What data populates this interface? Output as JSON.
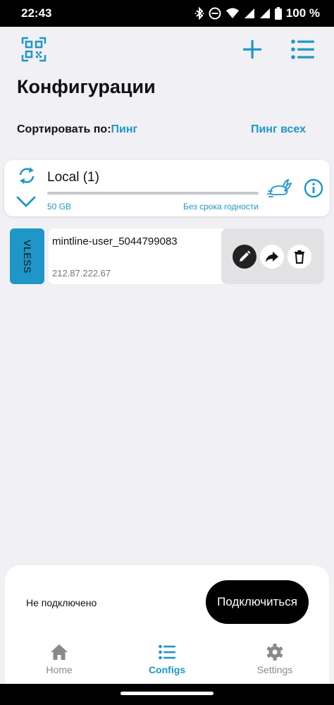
{
  "status_bar": {
    "time": "22:43",
    "battery": "100 %",
    "icons": [
      "bluetooth-icon",
      "do-not-disturb-icon",
      "wifi-icon",
      "signal-icon",
      "battery-icon"
    ]
  },
  "header": {
    "title": "Конфигурации",
    "icons": [
      "qr-scan-icon",
      "plus-icon",
      "list-icon"
    ]
  },
  "sort": {
    "label": "Сортировать по:",
    "value": "Пинг",
    "ping_all": "Пинг всех"
  },
  "group": {
    "name": "Local (1)",
    "size": "50 GB",
    "expiry": "Без срока годности",
    "usage_fraction": 0,
    "icons": [
      "refresh-icon",
      "chevron-down-icon",
      "rabbit-icon",
      "info-icon"
    ]
  },
  "configs": [
    {
      "protocol": "VLESS",
      "name": "mintline-user_5044799083",
      "address": "212.87.222.67",
      "actions": [
        "edit-icon",
        "share-icon",
        "delete-icon"
      ]
    }
  ],
  "connection": {
    "status": "Не подключено",
    "connect_label": "Подключиться"
  },
  "nav": {
    "items": [
      {
        "label": "Home",
        "icon": "home-icon"
      },
      {
        "label": "Configs",
        "icon": "list-icon",
        "active": true
      },
      {
        "label": "Settings",
        "icon": "gear-icon"
      }
    ]
  },
  "colors": {
    "accent": "#1e97c8",
    "background": "#f1f0f5",
    "card": "#ffffff",
    "button_dark": "#000000"
  }
}
